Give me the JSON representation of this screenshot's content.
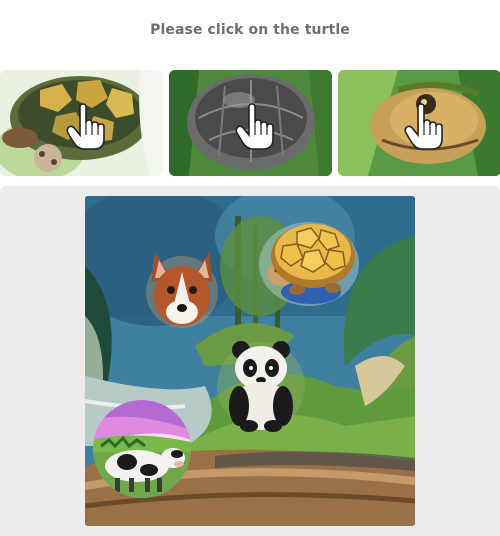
{
  "prompt": {
    "text": "Please click on the turtle"
  },
  "examples": [
    {
      "subject": "turtle",
      "icon": "hand-pointer-icon"
    },
    {
      "subject": "turtle",
      "icon": "hand-pointer-icon"
    },
    {
      "subject": "turtle",
      "icon": "hand-pointer-icon"
    }
  ],
  "scene": {
    "objects": [
      "dog",
      "turtle",
      "panda",
      "cow"
    ],
    "colors": {
      "panel_background": "#ececec",
      "prompt_text": "#6f6f6f"
    }
  }
}
